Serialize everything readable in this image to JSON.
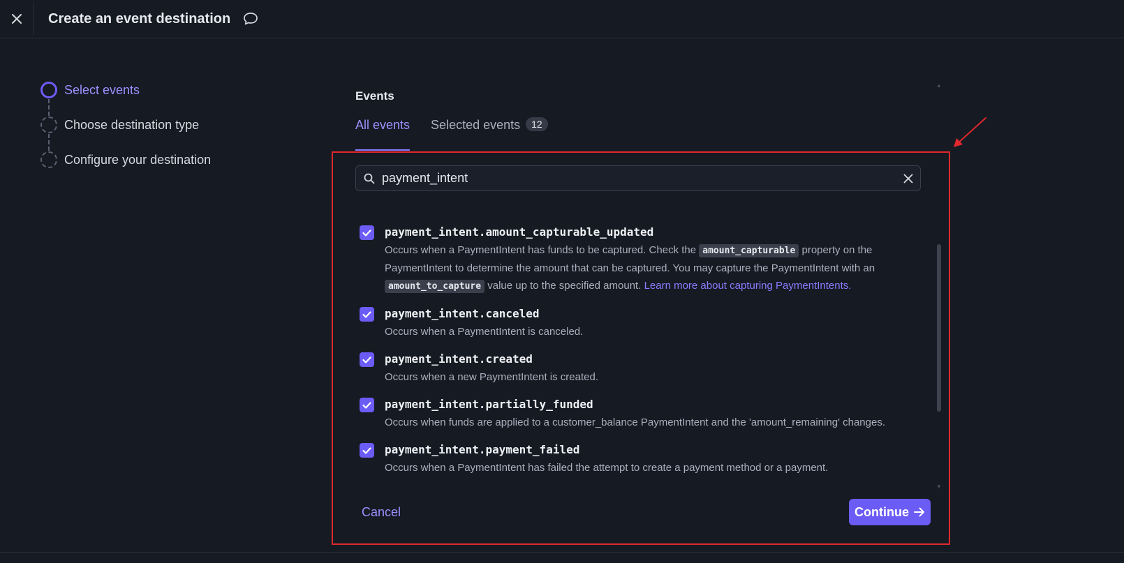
{
  "header": {
    "title": "Create an event destination",
    "close_icon": "close-icon",
    "feedback_icon": "chat-bubble-icon"
  },
  "steps": [
    {
      "label": "Select events",
      "state": "active"
    },
    {
      "label": "Choose destination type",
      "state": "pending"
    },
    {
      "label": "Configure your destination",
      "state": "pending"
    }
  ],
  "events_panel": {
    "heading": "Events",
    "tabs": [
      {
        "label": "All events",
        "active": true
      },
      {
        "label": "Selected events",
        "count": "12",
        "active": false
      }
    ],
    "search": {
      "value": "payment_intent",
      "placeholder": ""
    },
    "items": [
      {
        "name": "payment_intent.amount_capturable_updated",
        "checked": true,
        "desc_part1": "Occurs when a PaymentIntent has funds to be captured. Check the",
        "code1": "amount_capturable",
        "desc_part2": "property on the PaymentIntent to determine the amount that can be captured. You may capture the PaymentIntent with an",
        "code2": "amount_to_capture",
        "desc_part3": "value up to the specified amount.",
        "link": "Learn more about capturing PaymentIntents."
      },
      {
        "name": "payment_intent.canceled",
        "checked": true,
        "desc": "Occurs when a PaymentIntent is canceled."
      },
      {
        "name": "payment_intent.created",
        "checked": true,
        "desc": "Occurs when a new PaymentIntent is created."
      },
      {
        "name": "payment_intent.partially_funded",
        "checked": true,
        "desc": "Occurs when funds are applied to a customer_balance PaymentIntent and the 'amount_remaining' changes."
      },
      {
        "name": "payment_intent.payment_failed",
        "checked": true,
        "desc": "Occurs when a PaymentIntent has failed the attempt to create a payment method or a payment."
      }
    ]
  },
  "footer": {
    "cancel_label": "Cancel",
    "continue_label": "Continue"
  },
  "colors": {
    "background": "#161a23",
    "accent": "#6c5cf6",
    "accent_text": "#9d90ff",
    "annotation": "#e0282d"
  }
}
